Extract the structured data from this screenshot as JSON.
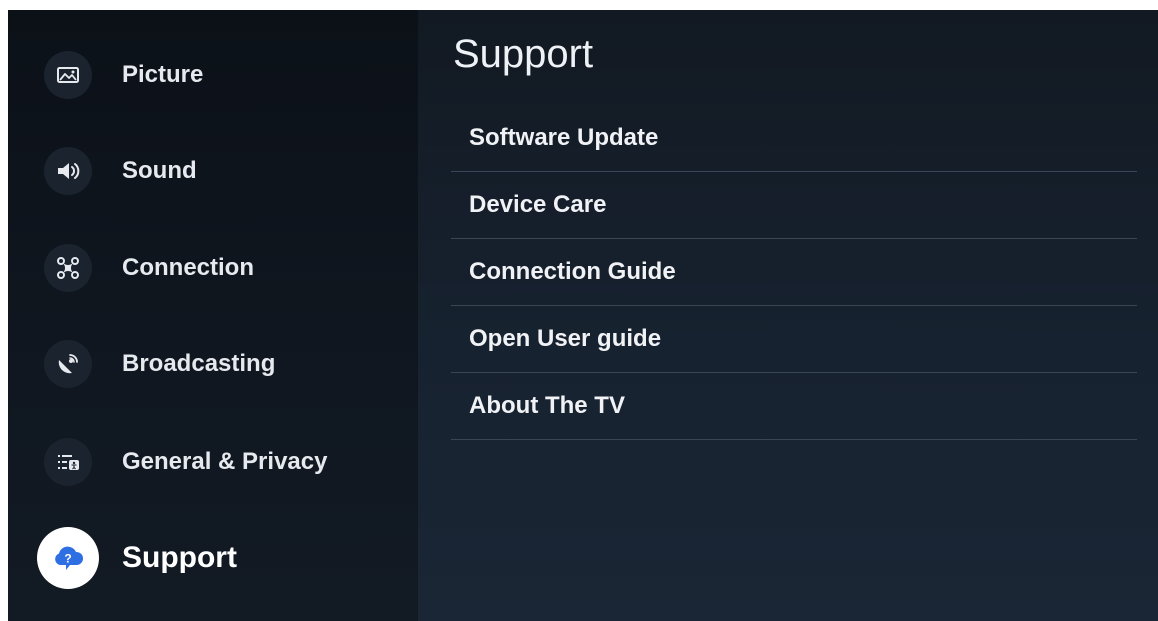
{
  "sidebar": {
    "items": [
      {
        "label": "Picture",
        "icon": "picture-icon"
      },
      {
        "label": "Sound",
        "icon": "speaker-icon"
      },
      {
        "label": "Connection",
        "icon": "connection-icon"
      },
      {
        "label": "Broadcasting",
        "icon": "satellite-dish-icon"
      },
      {
        "label": "General & Privacy",
        "icon": "general-privacy-icon"
      },
      {
        "label": "Support",
        "icon": "support-cloud-question-icon",
        "selected": true
      }
    ]
  },
  "main": {
    "title": "Support",
    "menu": [
      {
        "label": "Software Update"
      },
      {
        "label": "Device Care"
      },
      {
        "label": "Connection Guide"
      },
      {
        "label": "Open User guide"
      },
      {
        "label": "About The TV"
      }
    ]
  },
  "colors": {
    "accent": "#2f6fe4",
    "text": "#e6e9ee",
    "divider": "#3a4656"
  }
}
